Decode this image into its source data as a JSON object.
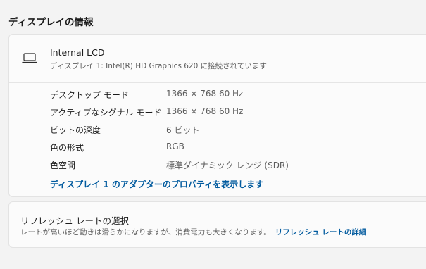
{
  "section": {
    "title": "ディスプレイの情報"
  },
  "display": {
    "icon": "laptop-icon",
    "name": "Internal LCD",
    "subtitle": "ディスプレイ 1: Intel(R) HD Graphics 620 に接続されています",
    "specs": [
      {
        "label": "デスクトップ モード",
        "value": "1366 × 768 60 Hz"
      },
      {
        "label": "アクティブなシグナル モード",
        "value": "1366 × 768 60 Hz"
      },
      {
        "label": "ビットの深度",
        "value": "6 ビット"
      },
      {
        "label": "色の形式",
        "value": "RGB"
      },
      {
        "label": "色空間",
        "value": "標準ダイナミック レンジ (SDR)"
      }
    ],
    "adapter_link": "ディスプレイ 1 のアダプターのプロパティを表示します"
  },
  "refresh": {
    "title": "リフレッシュ レートの選択",
    "description": "レートが高いほど動きは滑らかになりますが、消費電力も大きくなります。",
    "link": "リフレッシュ レートの詳細"
  }
}
